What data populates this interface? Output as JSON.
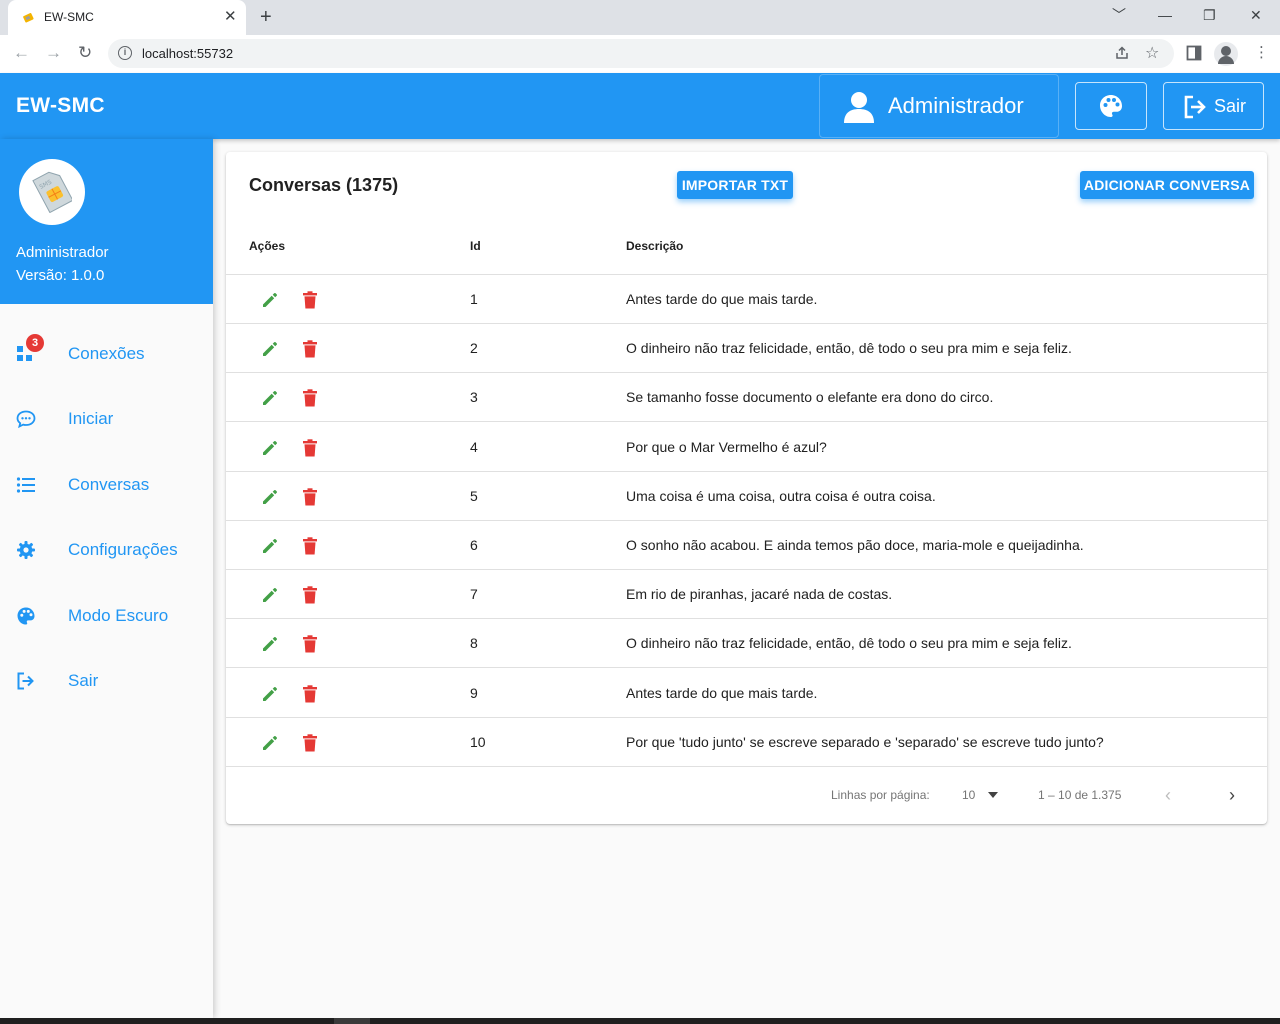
{
  "browser": {
    "tab_title": "EW-SMC",
    "tab_close": "✕",
    "new_tab": "+",
    "url": "localhost:55732",
    "window_controls": [
      "﹀",
      "—",
      "❐",
      "✕"
    ]
  },
  "header": {
    "title": "EW-SMC",
    "user_label": "Administrador",
    "logout_label": "Sair",
    "color": "#2196f3"
  },
  "sidebar": {
    "profile_name": "Administrador",
    "profile_version": "Versão: 1.0.0",
    "items": [
      {
        "label": "Conexões",
        "icon": "connections-icon",
        "badge": "3"
      },
      {
        "label": "Iniciar",
        "icon": "chat-icon"
      },
      {
        "label": "Conversas",
        "icon": "list-icon"
      },
      {
        "label": "Configurações",
        "icon": "gear-icon"
      },
      {
        "label": "Modo Escuro",
        "icon": "palette-icon"
      },
      {
        "label": "Sair",
        "icon": "logout-icon"
      }
    ]
  },
  "main": {
    "title": "Conversas (1375)",
    "import_label": "IMPORTAR TXT",
    "add_label": "ADICIONAR CONVERSA",
    "columns": [
      "Ações",
      "Id",
      "Descrição"
    ],
    "rows": [
      {
        "id": "1",
        "desc": "Antes tarde do que mais tarde."
      },
      {
        "id": "2",
        "desc": "O dinheiro não traz felicidade, então, dê todo o seu pra mim e seja feliz."
      },
      {
        "id": "3",
        "desc": "Se tamanho fosse documento o elefante era dono do circo."
      },
      {
        "id": "4",
        "desc": "Por que o Mar Vermelho é azul?"
      },
      {
        "id": "5",
        "desc": "Uma coisa é uma coisa, outra coisa é outra coisa."
      },
      {
        "id": "6",
        "desc": "O sonho não acabou. E ainda temos pão doce, maria-mole e queijadinha."
      },
      {
        "id": "7",
        "desc": "Em rio de piranhas, jacaré nada de costas."
      },
      {
        "id": "8",
        "desc": "O dinheiro não traz felicidade, então, dê todo o seu pra mim e seja feliz."
      },
      {
        "id": "9",
        "desc": "Antes tarde do que mais tarde."
      },
      {
        "id": "10",
        "desc": "Por que 'tudo junto' se escreve separado e 'separado' se escreve tudo junto?"
      }
    ],
    "footer": {
      "rows_per_page_label": "Linhas por página:",
      "rows_per_page_value": "10",
      "range": "1 – 10 de 1.375",
      "prev": "‹",
      "next": "›"
    }
  },
  "colors": {
    "edit": "#43a047",
    "delete": "#e53935",
    "accent": "#2196f3"
  }
}
